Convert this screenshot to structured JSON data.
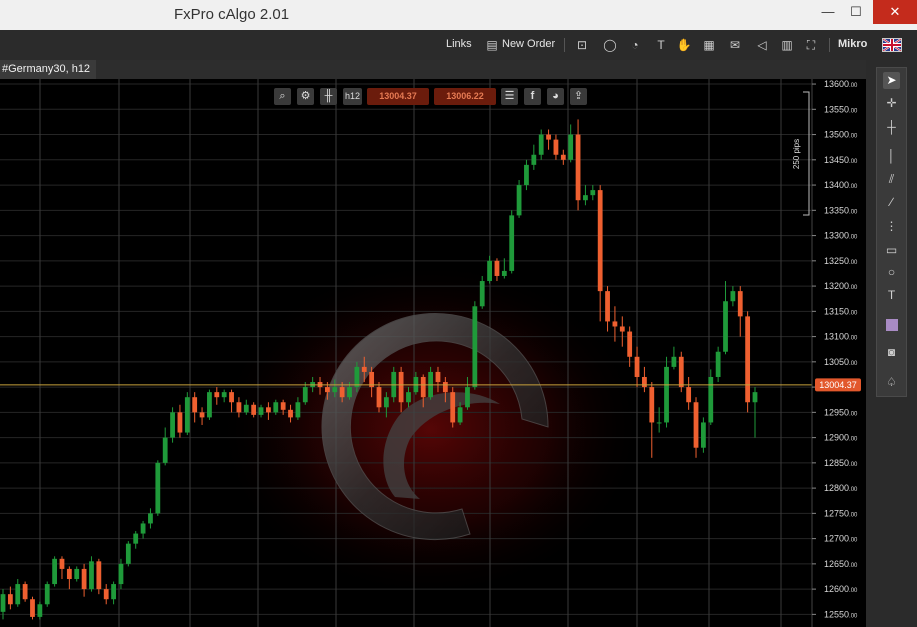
{
  "window": {
    "title": "FxPro cAlgo 2.01",
    "minimize": "—",
    "maximize": "☐",
    "close": "✕"
  },
  "toolbar": {
    "links": "Links",
    "new_order": "New Order",
    "mikro": "Mikro"
  },
  "tab": {
    "label": "#Germany30, h12"
  },
  "chart_toolbar": {
    "timeframe": "h12",
    "sell_price": "13004.37",
    "buy_price": "13006.22"
  },
  "chart_data": {
    "type": "candlestick",
    "symbol": "#Germany30",
    "timeframe": "h12",
    "ylim": [
      12525,
      13610
    ],
    "yticks": [
      "13600.00",
      "13550.00",
      "13500.00",
      "13450.00",
      "13400.00",
      "13350.00",
      "13300.00",
      "13250.00",
      "13200.00",
      "13150.00",
      "13100.00",
      "13050.00",
      "13000.00",
      "12950.00",
      "12900.00",
      "12850.00",
      "12800.00",
      "12750.00",
      "12700.00",
      "12650.00",
      "12600.00",
      "12550.00"
    ],
    "current_price": "13004.37",
    "range_label": "250 pips",
    "candles": [
      [
        12555,
        12590,
        12540,
        12600
      ],
      [
        12590,
        12570,
        12560,
        12605
      ],
      [
        12570,
        12610,
        12565,
        12620
      ],
      [
        12610,
        12580,
        12575,
        12615
      ],
      [
        12580,
        12545,
        12540,
        12585
      ],
      [
        12545,
        12570,
        12540,
        12575
      ],
      [
        12570,
        12610,
        12565,
        12615
      ],
      [
        12610,
        12660,
        12605,
        12665
      ],
      [
        12660,
        12640,
        12620,
        12665
      ],
      [
        12640,
        12620,
        12600,
        12645
      ],
      [
        12620,
        12640,
        12615,
        12645
      ],
      [
        12640,
        12600,
        12585,
        12650
      ],
      [
        12600,
        12655,
        12595,
        12665
      ],
      [
        12655,
        12600,
        12590,
        12660
      ],
      [
        12600,
        12580,
        12570,
        12610
      ],
      [
        12580,
        12610,
        12570,
        12615
      ],
      [
        12610,
        12650,
        12600,
        12660
      ],
      [
        12650,
        12690,
        12645,
        12695
      ],
      [
        12690,
        12710,
        12680,
        12715
      ],
      [
        12710,
        12730,
        12700,
        12735
      ],
      [
        12730,
        12750,
        12720,
        12760
      ],
      [
        12750,
        12850,
        12745,
        12855
      ],
      [
        12850,
        12900,
        12845,
        12920
      ],
      [
        12900,
        12950,
        12890,
        12960
      ],
      [
        12950,
        12910,
        12900,
        12965
      ],
      [
        12910,
        12980,
        12905,
        12990
      ],
      [
        12980,
        12950,
        12930,
        12990
      ],
      [
        12950,
        12940,
        12925,
        12960
      ],
      [
        12940,
        12990,
        12935,
        12995
      ],
      [
        12990,
        12980,
        12965,
        13000
      ],
      [
        12980,
        12990,
        12970,
        12995
      ],
      [
        12990,
        12970,
        12950,
        12995
      ],
      [
        12970,
        12950,
        12940,
        12980
      ],
      [
        12950,
        12965,
        12945,
        12975
      ],
      [
        12965,
        12945,
        12940,
        12970
      ],
      [
        12945,
        12960,
        12940,
        12965
      ],
      [
        12960,
        12950,
        12935,
        12970
      ],
      [
        12950,
        12970,
        12945,
        12975
      ],
      [
        12970,
        12955,
        12945,
        12975
      ],
      [
        12955,
        12940,
        12930,
        12965
      ],
      [
        12940,
        12970,
        12935,
        12980
      ],
      [
        12970,
        13000,
        12965,
        13010
      ],
      [
        13000,
        13010,
        12990,
        13020
      ],
      [
        13010,
        13000,
        12985,
        13020
      ],
      [
        13000,
        12990,
        12975,
        13010
      ],
      [
        12990,
        13000,
        12980,
        13015
      ],
      [
        13000,
        12980,
        12970,
        13010
      ],
      [
        12980,
        13000,
        12975,
        13010
      ],
      [
        13000,
        13040,
        12990,
        13050
      ],
      [
        13040,
        13030,
        13010,
        13060
      ],
      [
        13030,
        13000,
        12980,
        13040
      ],
      [
        13000,
        12960,
        12950,
        13010
      ],
      [
        12960,
        12980,
        12940,
        12990
      ],
      [
        12980,
        13030,
        12970,
        13040
      ],
      [
        13030,
        12970,
        12950,
        13040
      ],
      [
        12970,
        12990,
        12960,
        13000
      ],
      [
        12990,
        13020,
        12985,
        13030
      ],
      [
        13020,
        12980,
        12960,
        13025
      ],
      [
        12980,
        13030,
        12975,
        13040
      ],
      [
        13030,
        13010,
        12990,
        13040
      ],
      [
        13010,
        12990,
        12970,
        13020
      ],
      [
        12990,
        12930,
        12920,
        13000
      ],
      [
        12930,
        12960,
        12925,
        12970
      ],
      [
        12960,
        13000,
        12955,
        13020
      ],
      [
        13000,
        13160,
        12995,
        13170
      ],
      [
        13160,
        13210,
        13155,
        13220
      ],
      [
        13210,
        13250,
        13205,
        13260
      ],
      [
        13250,
        13220,
        13210,
        13255
      ],
      [
        13220,
        13230,
        13215,
        13255
      ],
      [
        13230,
        13340,
        13225,
        13350
      ],
      [
        13340,
        13400,
        13335,
        13410
      ],
      [
        13400,
        13440,
        13390,
        13450
      ],
      [
        13440,
        13460,
        13430,
        13480
      ],
      [
        13460,
        13500,
        13450,
        13510
      ],
      [
        13500,
        13490,
        13470,
        13510
      ],
      [
        13490,
        13460,
        13450,
        13500
      ],
      [
        13460,
        13450,
        13440,
        13470
      ],
      [
        13450,
        13500,
        13445,
        13520
      ],
      [
        13500,
        13370,
        13350,
        13530
      ],
      [
        13370,
        13380,
        13360,
        13400
      ],
      [
        13380,
        13390,
        13370,
        13400
      ],
      [
        13390,
        13190,
        13130,
        13400
      ],
      [
        13190,
        13130,
        13110,
        13200
      ],
      [
        13130,
        13120,
        13090,
        13160
      ],
      [
        13120,
        13110,
        13080,
        13140
      ],
      [
        13110,
        13060,
        13040,
        13120
      ],
      [
        13060,
        13020,
        13000,
        13080
      ],
      [
        13020,
        13000,
        12990,
        13040
      ],
      [
        13000,
        12930,
        12860,
        13010
      ],
      [
        12930,
        12930,
        12910,
        12960
      ],
      [
        12930,
        13040,
        12920,
        13060
      ],
      [
        13040,
        13060,
        13035,
        13080
      ],
      [
        13060,
        13000,
        12990,
        13070
      ],
      [
        13000,
        12970,
        12955,
        13020
      ],
      [
        12970,
        12880,
        12860,
        12980
      ],
      [
        12880,
        12930,
        12870,
        12940
      ],
      [
        12930,
        13020,
        12925,
        13035
      ],
      [
        13020,
        13070,
        13010,
        13080
      ],
      [
        13070,
        13170,
        13065,
        13210
      ],
      [
        13170,
        13190,
        13160,
        13200
      ],
      [
        13190,
        13140,
        13100,
        13200
      ],
      [
        13140,
        12970,
        12950,
        13150
      ],
      [
        12970,
        12990,
        12900,
        13000
      ]
    ]
  }
}
